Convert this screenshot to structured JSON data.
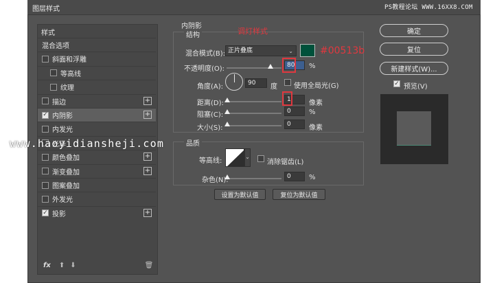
{
  "window": {
    "title": "图层样式"
  },
  "watermark_top": "PS教程论坛 WWW.16XX8.COM",
  "watermark_url": "www.haoyidiansheji.com",
  "left_panel": {
    "header": "样式",
    "items": [
      {
        "label": "混合选项",
        "checkbox": false,
        "checked": false,
        "plus": false,
        "indent": 0
      },
      {
        "label": "斜面和浮雕",
        "checkbox": true,
        "checked": false,
        "plus": false,
        "indent": 0
      },
      {
        "label": "等高线",
        "checkbox": true,
        "checked": false,
        "plus": false,
        "indent": 1
      },
      {
        "label": "纹理",
        "checkbox": true,
        "checked": false,
        "plus": false,
        "indent": 1
      },
      {
        "label": "描边",
        "checkbox": true,
        "checked": false,
        "plus": true,
        "indent": 0
      },
      {
        "label": "内阴影",
        "checkbox": true,
        "checked": true,
        "plus": true,
        "indent": 0,
        "selected": true
      },
      {
        "label": "内发光",
        "checkbox": true,
        "checked": false,
        "plus": false,
        "indent": 0
      },
      {
        "label": "光泽",
        "checkbox": true,
        "checked": false,
        "plus": false,
        "indent": 0
      },
      {
        "label": "颜色叠加",
        "checkbox": true,
        "checked": false,
        "plus": true,
        "indent": 0
      },
      {
        "label": "渐变叠加",
        "checkbox": true,
        "checked": false,
        "plus": true,
        "indent": 0
      },
      {
        "label": "图案叠加",
        "checkbox": true,
        "checked": false,
        "plus": false,
        "indent": 0
      },
      {
        "label": "外发光",
        "checkbox": true,
        "checked": false,
        "plus": false,
        "indent": 0
      },
      {
        "label": "投影",
        "checkbox": true,
        "checked": true,
        "plus": true,
        "indent": 0
      }
    ],
    "footer": {
      "fx": "fx",
      "up": "⬆",
      "down": "⬇",
      "trash": "🗑"
    }
  },
  "inner_shadow": {
    "section_title": "内阴影",
    "structure_title": "结构",
    "annotation": "调灯样式",
    "blend_mode_label": "混合模式(B):",
    "blend_mode_value": "正片叠底",
    "color_swatch": "#00513b",
    "color_note": "#00513b",
    "opacity_label": "不透明度(O):",
    "opacity_value": "80",
    "opacity_unit": "%",
    "opacity_fraction": 0.8,
    "angle_label": "角度(A):",
    "angle_value": "90",
    "angle_unit": "度",
    "global_light_label": "使用全局光(G)",
    "global_light_checked": false,
    "distance_label": "距离(D):",
    "distance_value": "1",
    "distance_unit": "像素",
    "choke_label": "阻塞(C):",
    "choke_value": "0",
    "choke_unit": "%",
    "size_label": "大小(S):",
    "size_value": "0",
    "size_unit": "像素",
    "quality_title": "品质",
    "contour_label": "等高线:",
    "antialias_label": "消除锯齿(L)",
    "antialias_checked": false,
    "noise_label": "杂色(N):",
    "noise_value": "0",
    "noise_unit": "%",
    "set_default_label": "设置为默认值",
    "reset_default_label": "复位为默认值"
  },
  "right_buttons": {
    "ok": "确定",
    "reset": "复位",
    "new_style": "新建样式(W)...",
    "preview_label": "预览(V)",
    "preview_checked": true
  }
}
